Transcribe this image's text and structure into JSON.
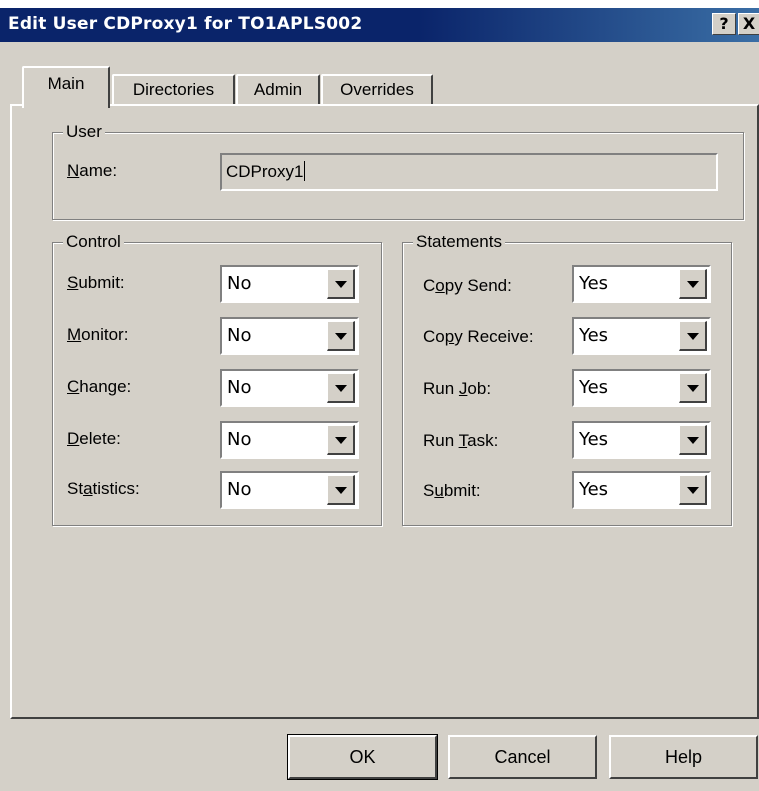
{
  "window": {
    "title": "Edit User CDProxy1 for TO1APLS002",
    "help_button": "?",
    "close_button": "X"
  },
  "tabs": [
    {
      "label": "Main",
      "active": true
    },
    {
      "label": "Directories",
      "active": false
    },
    {
      "label": "Admin",
      "active": false
    },
    {
      "label": "Overrides",
      "active": false
    }
  ],
  "user_group": {
    "title": "User",
    "name_label_u": "N",
    "name_label_rest": "ame:",
    "name_value": "CDProxy1"
  },
  "control_group": {
    "title": "Control",
    "rows": [
      {
        "pre": "",
        "u": "S",
        "post": "ubmit:",
        "value": "No"
      },
      {
        "pre": "",
        "u": "M",
        "post": "onitor:",
        "value": "No"
      },
      {
        "pre": "",
        "u": "C",
        "post": "hange:",
        "value": "No"
      },
      {
        "pre": "",
        "u": "D",
        "post": "elete:",
        "value": "No"
      },
      {
        "pre": "St",
        "u": "a",
        "post": "tistics:",
        "value": "No"
      }
    ]
  },
  "statements_group": {
    "title": "Statements",
    "rows": [
      {
        "pre": "C",
        "u": "o",
        "post": "py Send:",
        "value": "Yes"
      },
      {
        "pre": "Co",
        "u": "p",
        "post": "y Receive:",
        "value": "Yes"
      },
      {
        "pre": "Run ",
        "u": "J",
        "post": "ob:",
        "value": "Yes"
      },
      {
        "pre": "Run ",
        "u": "T",
        "post": "ask:",
        "value": "Yes"
      },
      {
        "pre": "S",
        "u": "u",
        "post": "bmit:",
        "value": "Yes"
      }
    ]
  },
  "buttons": {
    "ok": "OK",
    "cancel": "Cancel",
    "help": "Help"
  },
  "colors": {
    "title_bar": "#0a246a",
    "face": "#d4d0c8"
  }
}
